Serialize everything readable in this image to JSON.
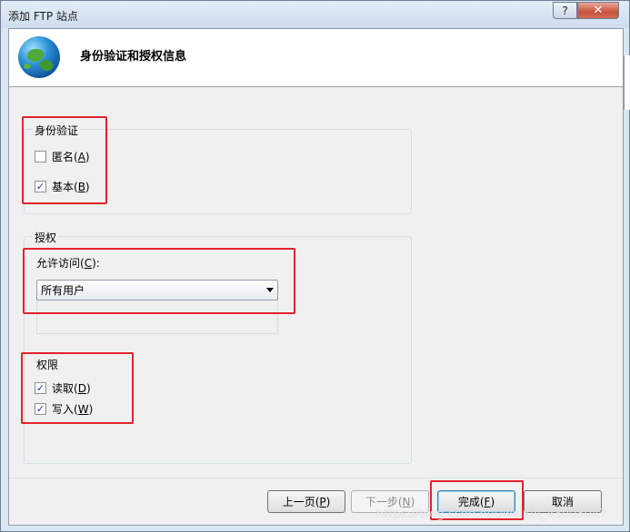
{
  "window": {
    "title": "添加 FTP 站点",
    "help_label": "?",
    "close_label": "✕"
  },
  "header": {
    "title": "身份验证和授权信息",
    "icon": "globe-icon"
  },
  "authentication": {
    "group_label": "身份验证",
    "anonymous": {
      "label": "匿名(",
      "accel": "A",
      "suffix": ")",
      "checked": false
    },
    "basic": {
      "label": "基本(",
      "accel": "B",
      "suffix": ")",
      "checked": true
    }
  },
  "authorization": {
    "group_label": "授权",
    "allow_access_label": "允许访问(",
    "allow_access_accel": "C",
    "allow_access_suffix": "):",
    "allow_access_value": "所有用户"
  },
  "permissions": {
    "group_label": "权限",
    "read": {
      "label": "读取(",
      "accel": "D",
      "suffix": ")",
      "checked": true
    },
    "write": {
      "label": "写入(",
      "accel": "W",
      "suffix": ")",
      "checked": true
    }
  },
  "buttons": {
    "prev": {
      "label": "上一页(",
      "accel": "P",
      "suffix": ")"
    },
    "next": {
      "label": "下一步(",
      "accel": "N",
      "suffix": ")"
    },
    "finish": {
      "label": "完成(",
      "accel": "F",
      "suffix": ")"
    },
    "cancel": {
      "label": "取消"
    }
  },
  "watermark": "https://blog.csdn.net/weixin_43008047",
  "colors": {
    "highlight_box": "#e3232a",
    "dialog_bg": "#f0f0f0",
    "frame": "#dbe6f3"
  }
}
